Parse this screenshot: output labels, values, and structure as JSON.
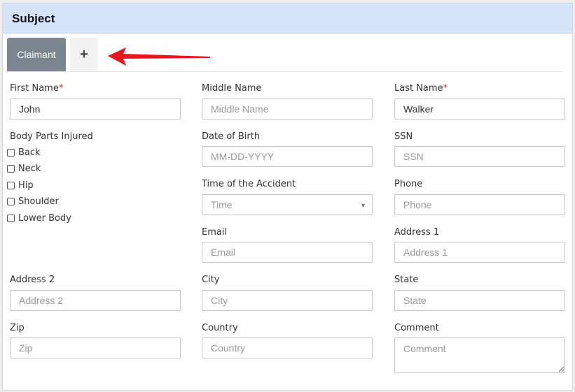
{
  "panel": {
    "title": "Subject"
  },
  "tabs": {
    "claimant_label": "Claimant",
    "add_label": "+"
  },
  "colors": {
    "header_bg": "#d5e3fb",
    "tab_active_bg": "#7a858f",
    "required": "#c0392b",
    "arrow": "#e8161b"
  },
  "icons": {
    "annotation": "red-arrow-icon",
    "select_caret": "caret-down-icon"
  },
  "form": {
    "first_name": {
      "label": "First Name",
      "required": "*",
      "value": "John"
    },
    "middle_name": {
      "label": "Middle Name",
      "placeholder": "Middle Name"
    },
    "last_name": {
      "label": "Last Name",
      "required": "*",
      "value": "Walker"
    },
    "body_parts": {
      "label": "Body Parts Injured",
      "options": [
        "Back",
        "Neck",
        "Hip",
        "Shoulder",
        "Lower Body"
      ]
    },
    "dob": {
      "label": "Date of Birth",
      "placeholder": "MM-DD-YYYY"
    },
    "ssn": {
      "label": "SSN",
      "placeholder": "SSN"
    },
    "time_of_accident": {
      "label": "Time of the Accident",
      "selected": "Time"
    },
    "phone": {
      "label": "Phone",
      "placeholder": "Phone"
    },
    "email": {
      "label": "Email",
      "placeholder": "Email"
    },
    "address1": {
      "label": "Address 1",
      "placeholder": "Address 1"
    },
    "address2": {
      "label": "Address 2",
      "placeholder": "Address 2"
    },
    "city": {
      "label": "City",
      "placeholder": "City"
    },
    "state": {
      "label": "State",
      "placeholder": "State"
    },
    "zip": {
      "label": "Zip",
      "placeholder": "Zip"
    },
    "country": {
      "label": "Country",
      "placeholder": "Country"
    },
    "comment": {
      "label": "Comment",
      "placeholder": "Comment"
    }
  }
}
